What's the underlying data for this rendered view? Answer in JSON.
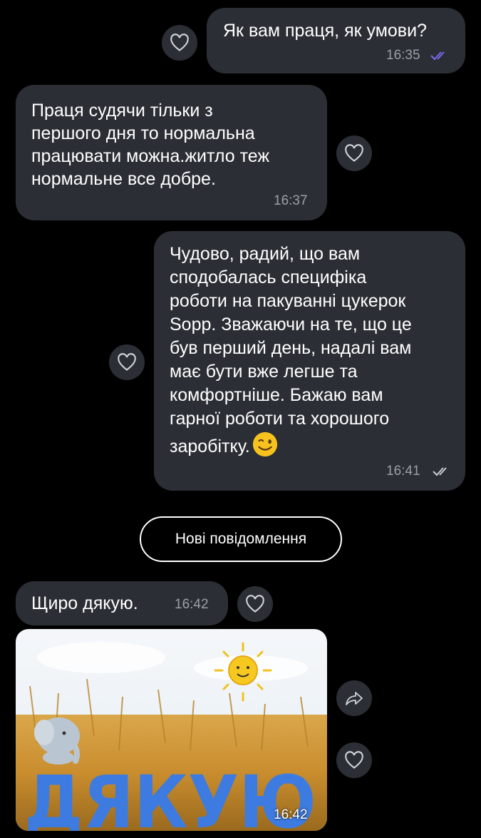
{
  "messages": [
    {
      "id": "m1",
      "direction": "outgoing",
      "text": "Як вам праця, як умови?",
      "time": "16:35",
      "status": "read"
    },
    {
      "id": "m2",
      "direction": "incoming",
      "text": "Праця судячи тільки з\nпершого дня то нормальна\nпрацювати можна.житло теж\nнормальне все добре.",
      "time": "16:37"
    },
    {
      "id": "m3",
      "direction": "outgoing",
      "text": "Чудово, радий, що вам\nсподобалась специфіка\nроботи на пакуванні цукерок\nSopp. Зважаючи на те, що це\nбув перший день, надалі вам\nмає бути вже легше та\nкомфортніше. Бажаю вам\nгарної роботи та хорошого\nзаробітку.",
      "emoji": "winking-face",
      "time": "16:41",
      "status": "delivered"
    },
    {
      "id": "m4",
      "direction": "incoming",
      "text": "Щиро дякую.",
      "time": "16:42"
    },
    {
      "id": "m5",
      "direction": "incoming",
      "type": "sticker",
      "sticker_text": "ДЯКУЮ",
      "time": "16:42"
    }
  ],
  "divider": {
    "label": "Нові повідомлення"
  },
  "colors": {
    "bubble": "#2b2f35",
    "background": "#000000",
    "read_ticks": "#7b68ee",
    "time": "#9aa0a6",
    "sticker_text": "#3d7be0"
  },
  "icons": [
    "heart-icon",
    "forward-icon",
    "double-check-icon",
    "sun-icon",
    "elephant-icon"
  ]
}
